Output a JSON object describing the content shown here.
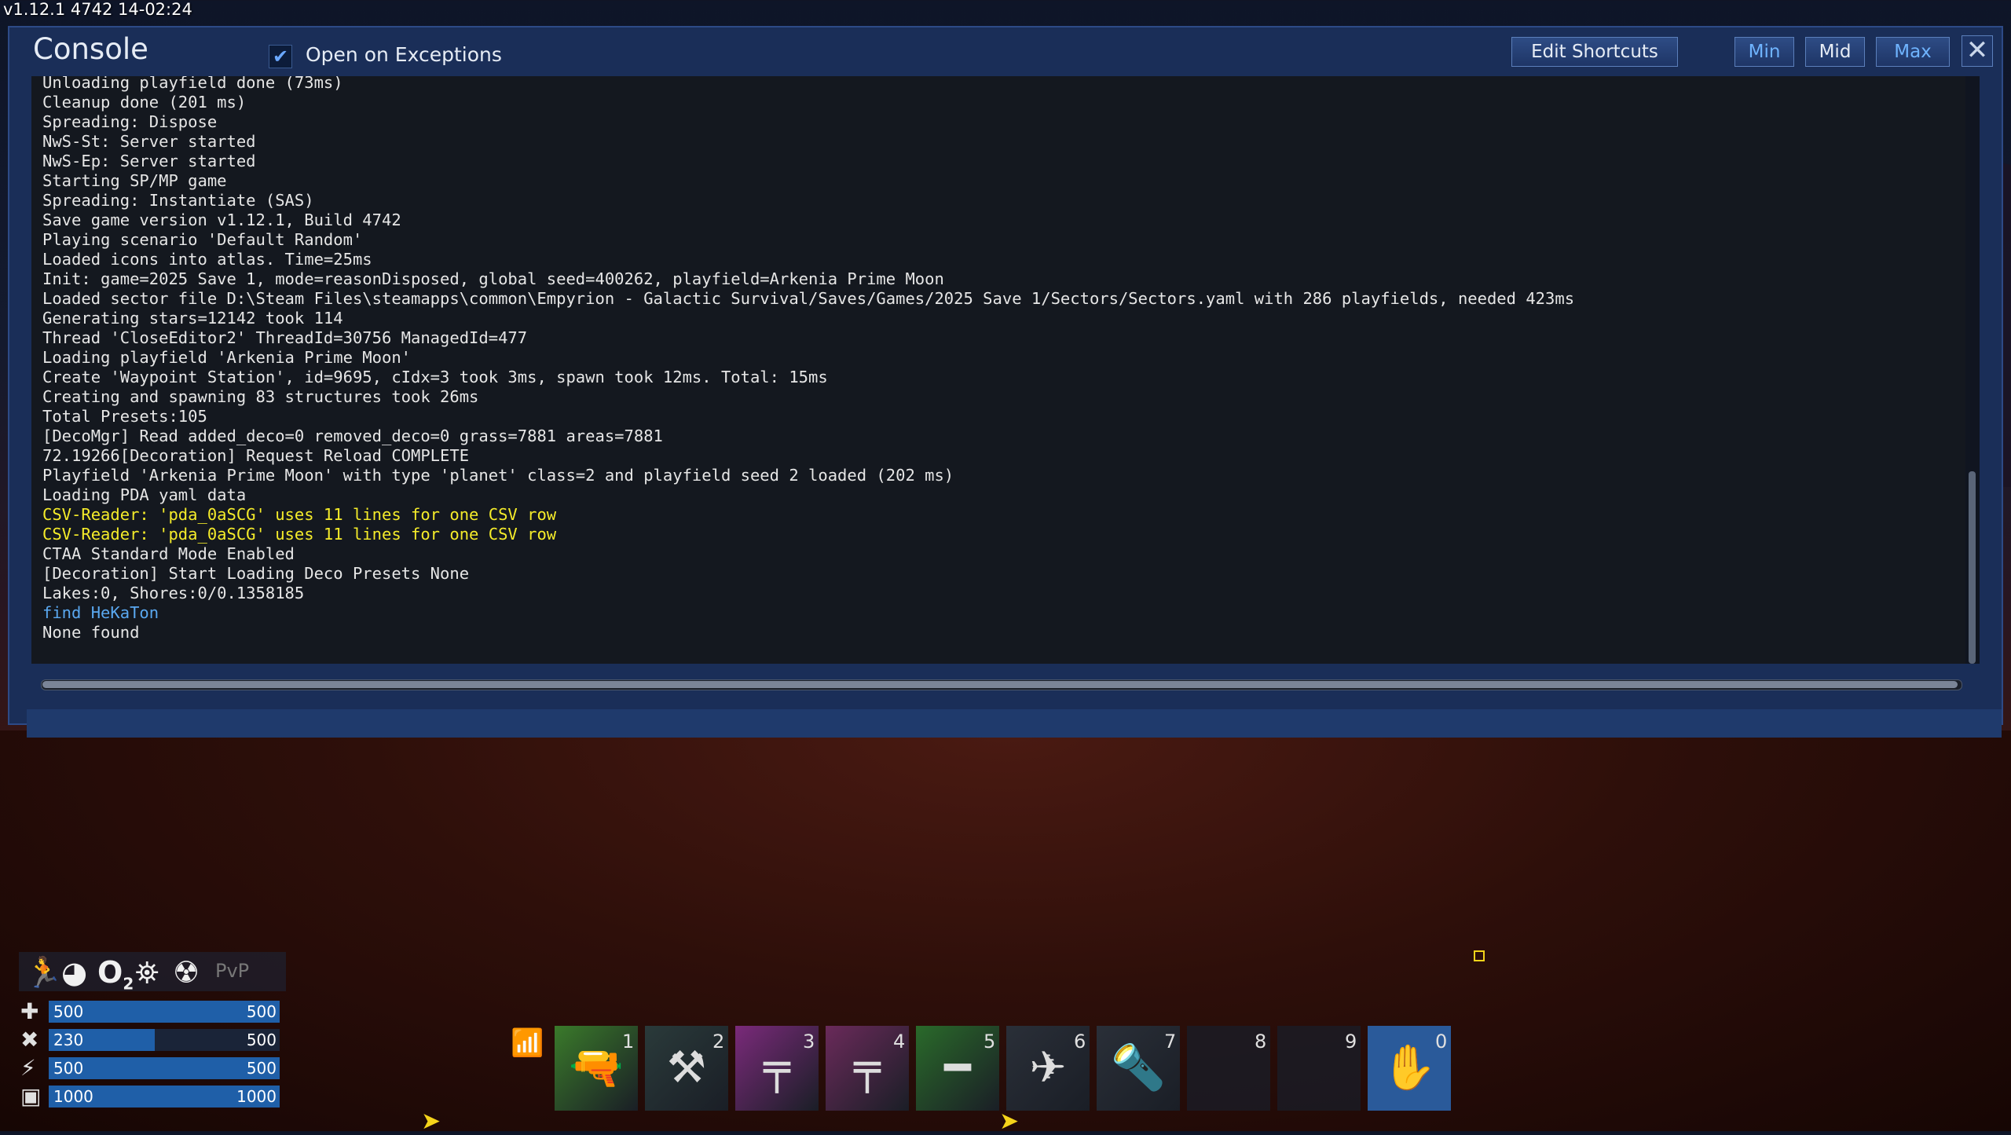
{
  "version_text": "v1.12.1 4742 14-02:24",
  "console": {
    "title": "Console",
    "open_on_exceptions_label": "Open on Exceptions",
    "open_on_exceptions_checked": true,
    "edit_shortcuts_label": "Edit Shortcuts",
    "min_label": "Min",
    "mid_label": "Mid",
    "max_label": "Max",
    "close_icon": "close-icon",
    "log_lines": [
      {
        "text": "Unloading playfield done (73ms)",
        "color": "white"
      },
      {
        "text": "Cleanup done (201 ms)",
        "color": "white"
      },
      {
        "text": "Spreading: Dispose",
        "color": "white"
      },
      {
        "text": "NwS-St: Server started",
        "color": "white"
      },
      {
        "text": "NwS-Ep: Server started",
        "color": "white"
      },
      {
        "text": "Starting SP/MP game",
        "color": "white"
      },
      {
        "text": "Spreading: Instantiate (SAS)",
        "color": "white"
      },
      {
        "text": "Save game version v1.12.1, Build 4742",
        "color": "white"
      },
      {
        "text": "Playing scenario 'Default Random'",
        "color": "white"
      },
      {
        "text": "Loaded icons into atlas. Time=25ms",
        "color": "white"
      },
      {
        "text": "Init: game=2025 Save 1, mode=reasonDisposed, global seed=400262, playfield=Arkenia Prime Moon",
        "color": "white"
      },
      {
        "text": "Loaded sector file D:\\Steam Files\\steamapps\\common\\Empyrion - Galactic Survival/Saves/Games/2025 Save 1/Sectors/Sectors.yaml with 286 playfields, needed 423ms",
        "color": "white"
      },
      {
        "text": "Generating stars=12142 took 114",
        "color": "white"
      },
      {
        "text": "Thread 'CloseEditor2' ThreadId=30756 ManagedId=477",
        "color": "white"
      },
      {
        "text": "Loading playfield 'Arkenia Prime Moon'",
        "color": "white"
      },
      {
        "text": "Create 'Waypoint Station', id=9695, cIdx=3 took 3ms, spawn took 12ms. Total: 15ms",
        "color": "white"
      },
      {
        "text": "Creating and spawning 83 structures took 26ms",
        "color": "white"
      },
      {
        "text": "Total Presets:105",
        "color": "white"
      },
      {
        "text": "[DecoMgr] Read added_deco=0 removed_deco=0 grass=7881 areas=7881",
        "color": "white"
      },
      {
        "text": "72.19266[Decoration] Request Reload COMPLETE",
        "color": "white"
      },
      {
        "text": "Playfield 'Arkenia Prime Moon' with type 'planet' class=2 and playfield seed 2 loaded (202 ms)",
        "color": "white"
      },
      {
        "text": "Loading PDA yaml data",
        "color": "white"
      },
      {
        "text": "CSV-Reader: 'pda_0aSCG' uses 11 lines for one CSV row",
        "color": "yellow"
      },
      {
        "text": "CSV-Reader: 'pda_0aSCG' uses 11 lines for one CSV row",
        "color": "yellow"
      },
      {
        "text": "CTAA Standard Mode Enabled",
        "color": "white"
      },
      {
        "text": "[Decoration] Start Loading Deco Presets None",
        "color": "white"
      },
      {
        "text": "Lakes:0, Shores:0/0.1358185",
        "color": "white"
      },
      {
        "text": "find HeKaTon",
        "color": "cyan"
      },
      {
        "text": "None found",
        "color": "white"
      }
    ],
    "command_input_value": ""
  },
  "hud": {
    "status_icons": [
      "running-icon",
      "food-icon",
      "oxygen-icon",
      "temperature-icon",
      "radiation-icon"
    ],
    "oxygen_label": "O",
    "oxygen_sub": "2",
    "pvp_label": "PvP",
    "bars": [
      {
        "icon": "health-icon",
        "current": "500",
        "max": "500",
        "fraction": 1.0
      },
      {
        "icon": "food-icon",
        "current": "230",
        "max": "500",
        "fraction": 0.46
      },
      {
        "icon": "stamina-icon",
        "current": "500",
        "max": "500",
        "fraction": 1.0
      },
      {
        "icon": "oxygen-tank-icon",
        "current": "1000",
        "max": "1000",
        "fraction": 1.0
      }
    ]
  },
  "hotbar": {
    "signal_icon": "wifi-icon",
    "slots": [
      {
        "number": "1",
        "item": "drill-icon",
        "color": "#3a7a2a"
      },
      {
        "number": "2",
        "item": "launcher-icon",
        "color": "#2a3a3a"
      },
      {
        "number": "3",
        "item": "rifle-icon",
        "color": "#7a2a7a"
      },
      {
        "number": "4",
        "item": "rifle-icon",
        "color": "#6a2a5a"
      },
      {
        "number": "5",
        "item": "sniper-icon",
        "color": "#2a6a2a"
      },
      {
        "number": "6",
        "item": "drone-icon",
        "color": "#2a2f38"
      },
      {
        "number": "7",
        "item": "flashlight-icon",
        "color": "#2a2f38"
      },
      {
        "number": "8",
        "item": "",
        "color": "#1e232c"
      },
      {
        "number": "9",
        "item": "",
        "color": "#1e232c"
      },
      {
        "number": "0",
        "item": "hand-icon",
        "color": "#2a5a9a"
      }
    ]
  },
  "colors": {
    "log_white": "#e6e6e6",
    "log_yellow": "#f5ec2a",
    "log_cyan": "#5aa8f0",
    "console_bg": "#1a2e58",
    "bar_fill": "#1f5fa8"
  }
}
